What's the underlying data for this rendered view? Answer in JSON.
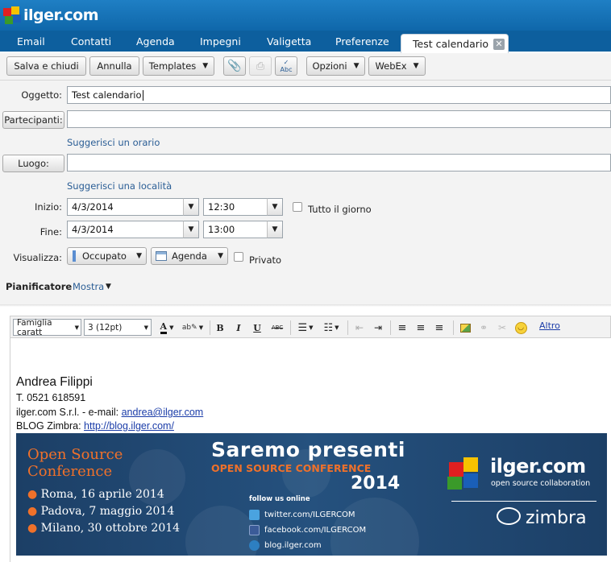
{
  "app": {
    "logo_text": "ilger.com"
  },
  "nav": {
    "items": [
      "Email",
      "Contatti",
      "Agenda",
      "Impegni",
      "Valigetta",
      "Preferenze"
    ],
    "active_tab": "Test calendario"
  },
  "toolbar": {
    "save_close": "Salva e chiudi",
    "cancel": "Annulla",
    "templates": "Templates",
    "options": "Opzioni",
    "webex": "WebEx"
  },
  "form": {
    "subject_label": "Oggetto:",
    "subject_value": "Test calendario",
    "participants_button": "Partecipanti:",
    "suggest_time": "Suggerisci un orario",
    "location_button": "Luogo:",
    "suggest_location": "Suggerisci una località",
    "start_label": "Inizio:",
    "start_date": "4/3/2014",
    "start_time": "12:30",
    "all_day_label": "Tutto il giorno",
    "end_label": "Fine:",
    "end_date": "4/3/2014",
    "end_time": "13:00",
    "show_label": "Visualizza:",
    "show_value": "Occupato",
    "calendar_value": "Agenda",
    "private_label": "Privato",
    "scheduler_label": "Pianificatore",
    "scheduler_link": "Mostra"
  },
  "editor": {
    "font_family": "Famiglia caratt",
    "font_size": "3 (12pt)",
    "more": "Altro"
  },
  "signature": {
    "name": "Andrea Filippi",
    "phone": "T. 0521 618591",
    "company_prefix": "ilger.com S.r.l. - e-mail: ",
    "email": "andrea@ilger.com",
    "blog_prefix": "BLOG Zimbra: ",
    "blog_url": "http://blog.ilger.com/"
  },
  "banner": {
    "conf_title_1": "Open Source",
    "conf_title_2": "Conference",
    "date_1": "Roma, 16 aprile 2014",
    "date_2": "Padova, 7 maggio 2014",
    "date_3": "Milano, 30 ottobre 2014",
    "headline": "Saremo presenti",
    "subheadline": "OPEN SOURCE CONFERENCE",
    "year": "2014",
    "follow": "follow us online",
    "twitter": "twitter.com/ILGERCOM",
    "facebook": "facebook.com/ILGERCOM",
    "blog": "blog.ilger.com",
    "brand": "ilger.com",
    "brand_tagline": "open source collaboration",
    "partner": "zimbra",
    "colors": {
      "navy": "#1c3f66",
      "orange": "#f0712a"
    }
  }
}
